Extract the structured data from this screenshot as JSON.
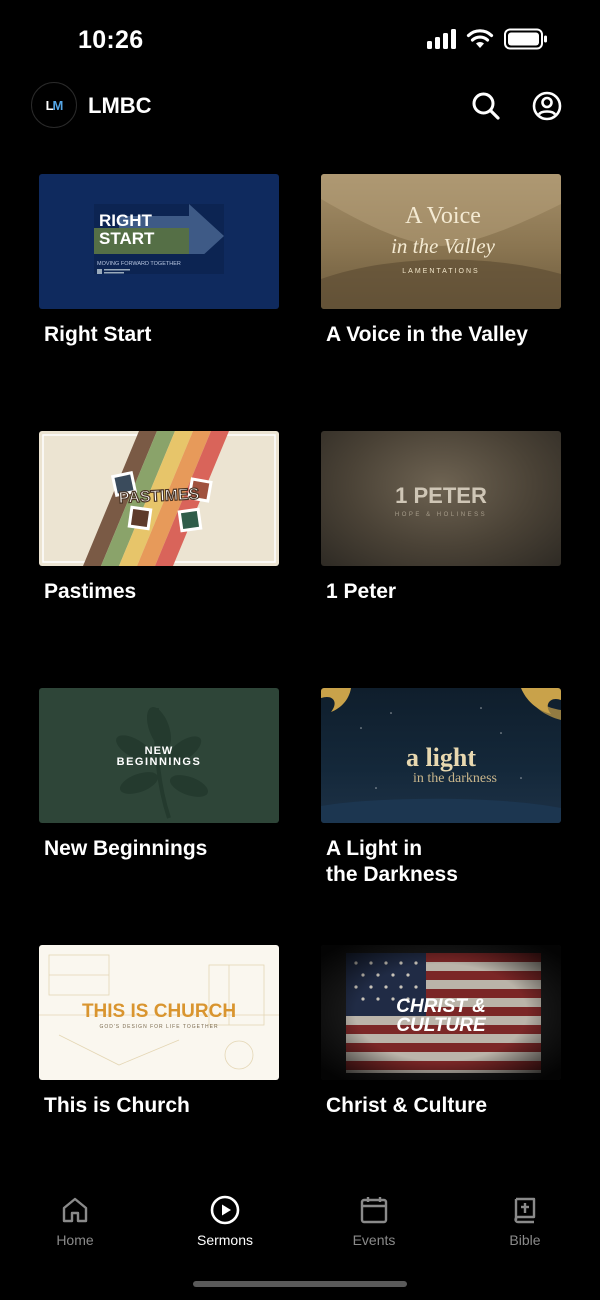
{
  "status_bar": {
    "time": "10:26"
  },
  "header": {
    "title": "LMBC",
    "logo_text_l": "L",
    "logo_text_m": "M"
  },
  "sermons": [
    {
      "title": "Right Start",
      "art_line1": "RIGHT",
      "art_line2": "START",
      "art_sub": "MOVING FORWARD TOGETHER"
    },
    {
      "title": "A Voice in the Valley",
      "art_line1": "A Voice",
      "art_line2": "in the Valley",
      "art_sub": "LAMENTATIONS"
    },
    {
      "title": "Pastimes",
      "art_line1": "PASTIMES"
    },
    {
      "title": "1 Peter",
      "art_line1": "1 PETER",
      "art_sub": "HOPE & HOLINESS"
    },
    {
      "title": "New Beginnings",
      "art_line1": "NEW",
      "art_line2": "BEGINNINGS"
    },
    {
      "title": "A Light in\nthe Darkness",
      "art_line1": "a light",
      "art_line2": "in the darkness"
    },
    {
      "title": "This is Church",
      "art_line1": "THIS IS CHURCH",
      "art_sub": "GOD'S DESIGN FOR LIFE TOGETHER"
    },
    {
      "title": "Christ & Culture",
      "art_line1": "CHRIST &",
      "art_line2": "CULTURE"
    }
  ],
  "tabs": [
    {
      "label": "Home",
      "icon": "home-icon",
      "active": false
    },
    {
      "label": "Sermons",
      "icon": "play-circle-icon",
      "active": true
    },
    {
      "label": "Events",
      "icon": "calendar-icon",
      "active": false
    },
    {
      "label": "Bible",
      "icon": "bible-icon",
      "active": false
    }
  ],
  "colors": {
    "background": "#000000",
    "tab_inactive": "#8a8a8a",
    "tab_active": "#ffffff",
    "logo_accent": "#55a6e6"
  }
}
